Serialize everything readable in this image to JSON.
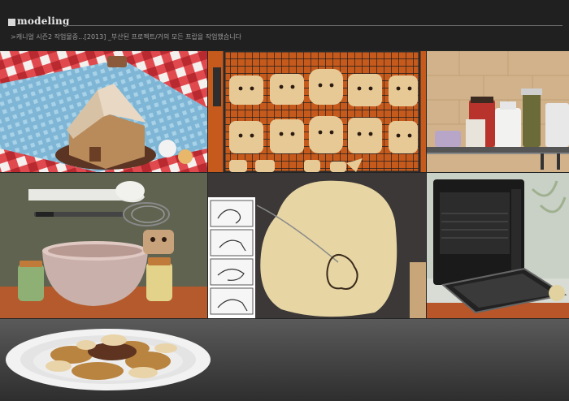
{
  "header": {
    "title": "modeling",
    "subtitle": ">캐니얼 시즌2 작업물중...[2013] _부산된 프로젝트/거의 모든 프랍을 작업했습니다"
  },
  "gallery": {
    "images": [
      {
        "icon": "gingerbread-house-render"
      },
      {
        "icon": "cookies-on-rack-render"
      },
      {
        "icon": "kitchen-shelf-render"
      },
      {
        "icon": "mixing-bowl-whisk-render"
      },
      {
        "icon": "dough-cutter-storyboard-render"
      },
      {
        "icon": "toaster-oven-render"
      },
      {
        "icon": "cookie-plate-render"
      }
    ]
  }
}
